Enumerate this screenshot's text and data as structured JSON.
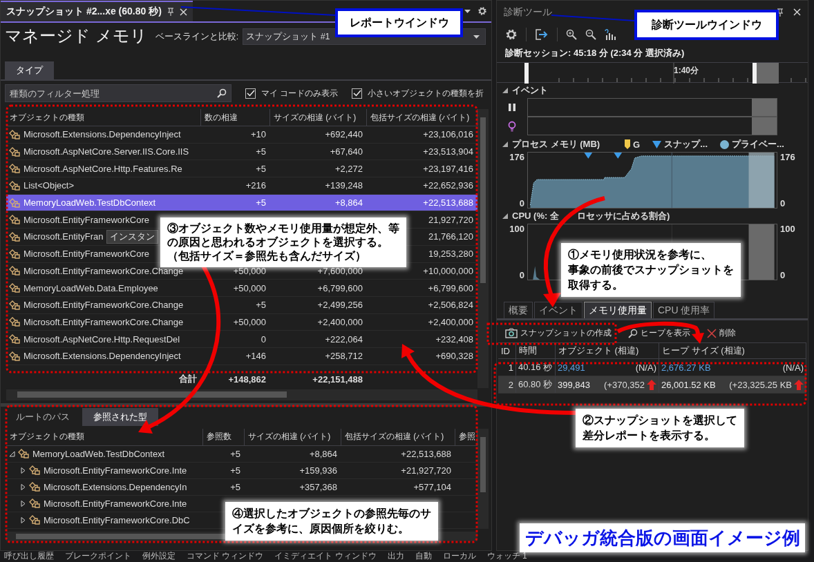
{
  "report": {
    "tab_title": "スナップショット #2...xe (60.80 秒)",
    "heading": "マネージド メモリ",
    "baseline_label": "ベースラインと比較:",
    "baseline_value": "スナップショット #1",
    "tabs": [
      {
        "label": "タイプ",
        "selected": true
      }
    ],
    "filter": {
      "placeholder": "種類のフィルター処理"
    },
    "options": [
      {
        "label": "マイ コードのみ表示",
        "checked": true
      },
      {
        "label": "小さいオブジェクトの種類を折",
        "checked": true
      }
    ],
    "types_table": {
      "columns": [
        "オブジェクトの種類",
        "数の相違",
        "サイズの相違 (バイト)",
        "包括サイズの相違 (バイト)"
      ],
      "rows": [
        {
          "name": "Microsoft.Extensions.DependencyInject",
          "count": "+10",
          "size": "+692,440",
          "inclusive": "+23,106,016",
          "selected": false
        },
        {
          "name": "Microsoft.AspNetCore.Server.IIS.Core.IIS",
          "count": "+5",
          "size": "+67,640",
          "inclusive": "+23,513,904",
          "selected": false
        },
        {
          "name": "Microsoft.AspNetCore.Http.Features.Re",
          "count": "+5",
          "size": "+2,272",
          "inclusive": "+23,197,416",
          "selected": false
        },
        {
          "name": "List<Object>",
          "count": "+216",
          "size": "+139,248",
          "inclusive": "+22,652,936",
          "selected": false
        },
        {
          "name": "MemoryLoadWeb.TestDbContext",
          "count": "+5",
          "size": "+8,864",
          "inclusive": "+22,513,688",
          "selected": true
        },
        {
          "name": "Microsoft.EntityFrameworkCore",
          "inclusive": "21,927,720",
          "selected": false
        },
        {
          "name": "Microsoft.EntityFran",
          "tooltip": "インスタン",
          "inclusive": "21,766,120",
          "selected": false
        },
        {
          "name": "Microsoft.EntityFrameworkCore",
          "inclusive": "19,253,280",
          "selected": false
        },
        {
          "name": "Microsoft.EntityFrameworkCore.Change",
          "count": "+50,000",
          "size": "+7,600,000",
          "inclusive": "+10,000,000",
          "selected": false
        },
        {
          "name": "MemoryLoadWeb.Data.Employee",
          "count": "+50,000",
          "size": "+6,799,600",
          "inclusive": "+6,799,600",
          "selected": false
        },
        {
          "name": "Microsoft.EntityFrameworkCore.Change",
          "count": "+5",
          "size": "+2,499,256",
          "inclusive": "+2,506,824",
          "selected": false
        },
        {
          "name": "Microsoft.EntityFrameworkCore.Change",
          "count": "+50,000",
          "size": "+2,400,000",
          "inclusive": "+2,400,000",
          "selected": false
        },
        {
          "name": "Microsoft.AspNetCore.Http.RequestDel",
          "count": "0",
          "size": "+222,064",
          "inclusive": "+232,408",
          "selected": false
        },
        {
          "name": "Microsoft.Extensions.DependencyInject",
          "count": "+146",
          "size": "+258,712",
          "inclusive": "+690,328",
          "selected": false
        }
      ],
      "total": {
        "label": "合計",
        "count": "+148,862",
        "size": "+22,151,488"
      }
    },
    "references": {
      "tabs": [
        {
          "label": "ルートのパス",
          "selected": false
        },
        {
          "label": "参照された型",
          "selected": true
        }
      ],
      "columns": [
        "オブジェクトの種類",
        "参照数",
        "サイズの相違 (バイト)",
        "包括サイズの相違 (バイト)",
        "参照"
      ],
      "rows": [
        {
          "name": "MemoryLoadWeb.TestDbContext",
          "refs": "+5",
          "size": "+8,864",
          "inclusive": "+22,513,688",
          "expanded": true,
          "children": [
            {
              "name": "Microsoft.EntityFrameworkCore.Inte",
              "refs": "+5",
              "size": "+159,936",
              "inclusive": "+21,927,720",
              "expanded": false
            },
            {
              "name": "Microsoft.Extensions.DependencyIn",
              "refs": "+5",
              "size": "+357,368",
              "inclusive": "+577,104",
              "expanded": false
            },
            {
              "name": "Microsoft.EntityFrameworkCore.Inte",
              "expanded": false
            },
            {
              "name": "Microsoft.EntityFrameworkCore.DbC",
              "expanded": false
            }
          ]
        }
      ]
    }
  },
  "diag": {
    "title": "診断ツール",
    "session": "診断セッション: 45:18 分 (2:34 分 選択済み)",
    "ruler_label": "1:40分",
    "events_title": "イベント",
    "memory": {
      "title": "プロセス メモリ (MB)",
      "legend": [
        {
          "label": "G",
          "kind": "gc"
        },
        {
          "label": "スナップ...",
          "kind": "snapshot"
        },
        {
          "label": "プライベー...",
          "kind": "private"
        }
      ],
      "left_axis": [
        "176",
        "0"
      ],
      "right_axis": [
        "176",
        "0"
      ]
    },
    "cpu": {
      "title_parts": [
        "CPU (%: 全",
        "ロセッサに占める割合)"
      ],
      "left_axis": [
        "100",
        "0"
      ],
      "right_axis": [
        "100",
        "0"
      ]
    },
    "tabs": [
      {
        "label": "概要",
        "selected": false
      },
      {
        "label": "イベント",
        "selected": false
      },
      {
        "label": "メモリ使用量",
        "selected": true
      },
      {
        "label": "CPU 使用率",
        "selected": false
      }
    ],
    "actions": [
      {
        "label": "スナップショットの作成",
        "kind": "camera"
      },
      {
        "label": "ヒープを表示",
        "kind": "search"
      },
      {
        "label": "削除",
        "kind": "delete"
      }
    ],
    "snapshots": {
      "columns": [
        "ID",
        "時間",
        "オブジェクト (相違)",
        "ヒープ サイズ (相違)"
      ],
      "rows": [
        {
          "id": "1",
          "time": "40.16 秒",
          "objects": "29,491",
          "objects_diff": "(N/A)",
          "heap": "2,676.27 KB",
          "heap_diff": "(N/A)",
          "increase": false,
          "selected": false
        },
        {
          "id": "2",
          "time": "60.80 秒",
          "objects": "399,843",
          "objects_diff": "(+370,352",
          "heap": "26,001.52 KB",
          "heap_diff": "(+23,325.25 KB",
          "increase": true,
          "selected": true
        }
      ]
    }
  },
  "window_labels": [
    "レポートウインドウ",
    "診断ツールウインドウ"
  ],
  "callouts": [
    {
      "lines": [
        "③オブジェクト数やメモリ使用量が想定外、等",
        "の原因と思われるオブジェクトを選択する。",
        "（包括サイズ＝参照先も含んだサイズ）"
      ]
    },
    {
      "lines": [
        "①メモリ使用状況を参考に、",
        "事象の前後でスナップショットを",
        "取得する。"
      ]
    },
    {
      "lines": [
        "②スナップショットを選択して",
        "差分レポートを表示する。"
      ]
    },
    {
      "lines": [
        "④選択したオブジェクトの参照先毎のサ",
        "イズを参考に、原因個所を絞りむ。"
      ]
    }
  ],
  "caption": "デバッガ統合版の画面イメージ例",
  "bottom_tabs": [
    "呼び出し履歴",
    "ブレークポイント",
    "例外設定",
    "コマンド ウィンドウ",
    "イミディエイト ウィンドウ",
    "出力",
    "自動",
    "ローカル",
    "ウォッチ 1"
  ]
}
